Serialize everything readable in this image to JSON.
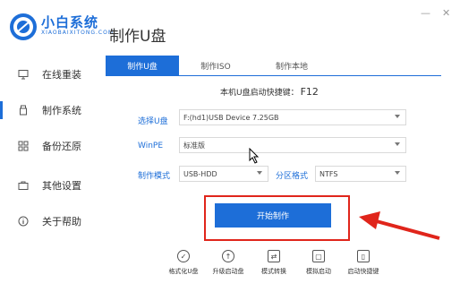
{
  "app": {
    "brand": "小白系统",
    "brand_sub": "XIAOBAIXITONG.COM",
    "page_title": "制作U盘"
  },
  "window_controls": {
    "minimize": "—",
    "close": "✕"
  },
  "sidebar": {
    "items": [
      {
        "label": "在线重装",
        "icon": "monitor-icon"
      },
      {
        "label": "制作系统",
        "icon": "usb-icon",
        "active": true
      },
      {
        "label": "备份还原",
        "icon": "backup-icon"
      },
      {
        "label": "其他设置",
        "icon": "briefcase-icon"
      },
      {
        "label": "关于帮助",
        "icon": "info-icon"
      }
    ]
  },
  "tabs": [
    {
      "label": "制作U盘",
      "active": true
    },
    {
      "label": "制作ISO"
    },
    {
      "label": "制作本地"
    }
  ],
  "hotkey": {
    "label": "本机U盘启动快捷键：",
    "key": "F12"
  },
  "form": {
    "usb_label": "选择U盘",
    "usb_value": "F:(hd1)USB Device 7.25GB",
    "winpe_label": "WinPE",
    "winpe_value": "标准版",
    "mode_label": "制作模式",
    "mode_value": "USB-HDD",
    "fs_label": "分区格式",
    "fs_value": "NTFS"
  },
  "start_button": "开始制作",
  "tools": [
    {
      "label": "格式化U盘",
      "icon": "check-circle-icon"
    },
    {
      "label": "升级启动盘",
      "icon": "upload-icon"
    },
    {
      "label": "模式转换",
      "icon": "convert-icon"
    },
    {
      "label": "模拟启动",
      "icon": "simulate-icon"
    },
    {
      "label": "启动快捷键",
      "icon": "mouse-icon"
    }
  ],
  "colors": {
    "accent": "#1d6ed8",
    "highlight": "#e0251b"
  }
}
